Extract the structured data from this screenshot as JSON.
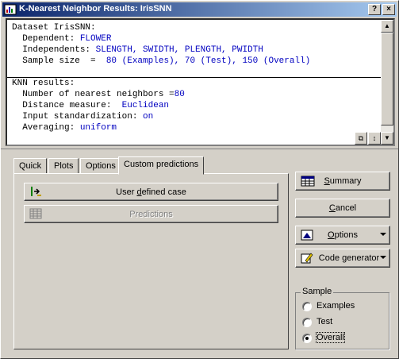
{
  "window": {
    "title": "K-Nearest Neighbor Results: IrisSNN",
    "help_glyph": "?",
    "close_glyph": "×"
  },
  "output": {
    "dataset_line": "Dataset IrisSNN:",
    "dependent_label": "  Dependent: ",
    "dependent_value": "FLOWER",
    "independents_label": "  Independents: ",
    "independents_value": "SLENGTH, SWIDTH, PLENGTH, PWIDTH",
    "sample_label": "  Sample size  =  ",
    "sample_value": "80 (Examples), 70 (Test), 150 (Overall)",
    "results_line": "KNN results:",
    "neighbors_label": "  Number of nearest neighbors =",
    "neighbors_value": "80",
    "distance_label": "  Distance measure:  ",
    "distance_value": "Euclidean",
    "standardization_label": "  Input standardization: ",
    "standardization_value": "on",
    "averaging_label": "  Averaging: ",
    "averaging_value": "uniform"
  },
  "tabs": [
    {
      "label": "Quick",
      "active": false
    },
    {
      "label": "Plots",
      "active": false
    },
    {
      "label": "Options",
      "active": false
    },
    {
      "label": "Custom predictions",
      "active": true
    }
  ],
  "custom_predictions": {
    "user_defined_case_pre": "User ",
    "user_defined_case_mnemonic": "d",
    "user_defined_case_post": "efined case",
    "predictions_label": "Predictions"
  },
  "side_buttons": {
    "summary": "ummary",
    "summary_mnemonic": "S",
    "cancel": "ancel",
    "cancel_mnemonic": "C",
    "options": "ptions",
    "options_mnemonic": "O",
    "code_generator": "Code generator"
  },
  "sample": {
    "legend": "Sample",
    "options": [
      "Examples",
      "Test",
      "Overall"
    ],
    "selected": "Overall"
  }
}
